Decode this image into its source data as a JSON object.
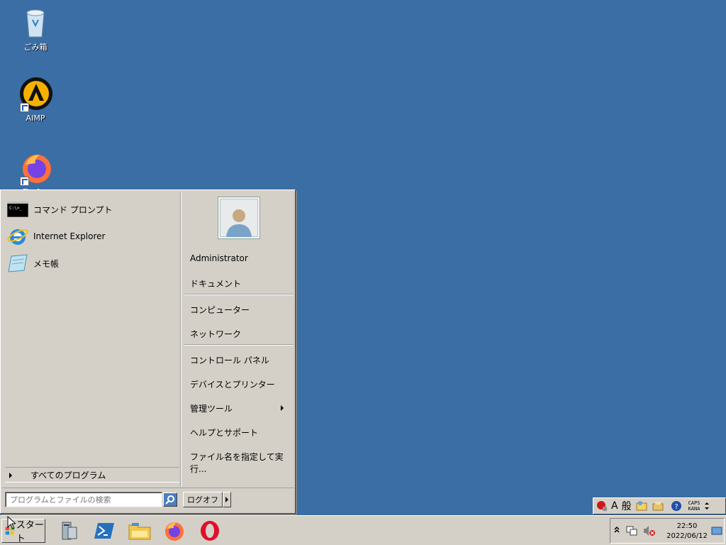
{
  "desktop": {
    "icons": [
      {
        "label": "ごみ箱",
        "icon": "recycle-bin-icon"
      },
      {
        "label": "AIMP",
        "icon": "aimp-icon"
      },
      {
        "label": "Firefox",
        "icon": "firefox-icon"
      }
    ]
  },
  "start_menu": {
    "programs": [
      {
        "label": "コマンド プロンプト",
        "icon": "command-prompt-icon"
      },
      {
        "label": "Internet Explorer",
        "icon": "internet-explorer-icon"
      },
      {
        "label": "メモ帳",
        "icon": "notepad-icon"
      }
    ],
    "all_programs_label": "すべてのプログラム",
    "search_placeholder": "プログラムとファイルの検索",
    "right_items": {
      "user": "Administrator",
      "documents": "ドキュメント",
      "computer": "コンピューター",
      "network": "ネットワーク",
      "control_panel": "コントロール パネル",
      "devices_printers": "デバイスとプリンター",
      "admin_tools": "管理ツール",
      "help_support": "ヘルプとサポート",
      "run": "ファイル名を指定して実行..."
    },
    "logoff_label": "ログオフ"
  },
  "language_bar": {
    "input_mode": "A",
    "ime_mode": "般",
    "caps": "CAPS",
    "kana": "KANA",
    "help": "?"
  },
  "taskbar": {
    "start_label": "スタート",
    "pinned": [
      "server-manager-icon",
      "powershell-icon",
      "file-explorer-icon",
      "firefox-icon",
      "opera-icon"
    ],
    "clock_time": "22:50",
    "clock_date": "2022/06/12"
  },
  "colors": {
    "desktop": "#3a6ea5",
    "face": "#d4d0c8"
  }
}
